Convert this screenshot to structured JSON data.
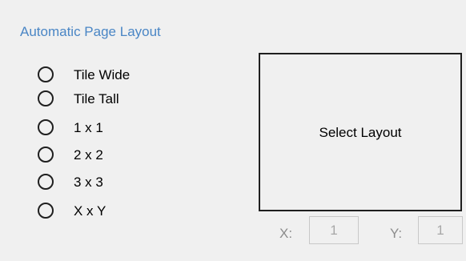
{
  "group": {
    "title": "Automatic Page Layout"
  },
  "options": [
    {
      "label": "Tile Wide",
      "selected": false
    },
    {
      "label": "Tile Tall",
      "selected": false
    },
    {
      "label": "1 x 1",
      "selected": false
    },
    {
      "label": "2 x 2",
      "selected": false
    },
    {
      "label": "3 x 3",
      "selected": false
    },
    {
      "label": "X x Y",
      "selected": false
    }
  ],
  "preview": {
    "label": "Select Layout"
  },
  "dimensions": {
    "x_label": "X:",
    "x_value": "1",
    "y_label": "Y:",
    "y_value": "1"
  },
  "colors": {
    "background": "#f0f0f0",
    "group_title": "#4a86c5",
    "disabled_text": "#8c8c8c",
    "border": "#1f1f1f"
  }
}
